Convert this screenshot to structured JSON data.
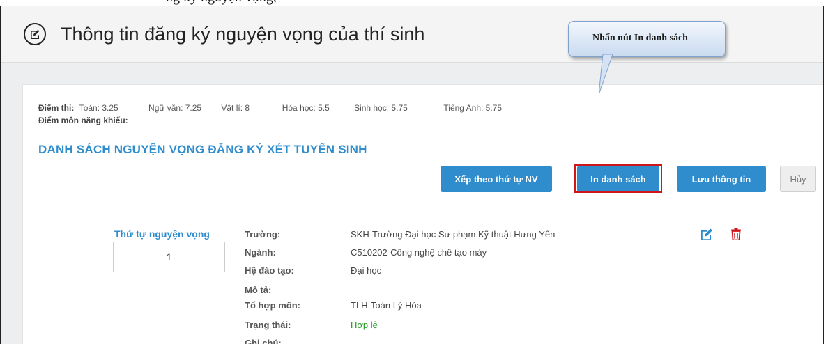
{
  "top_fragment": "ng ký nguyện vọng, ",
  "header": {
    "title": "Thông tin đăng ký nguyện vọng của thí sinh",
    "icon": "edit-circle-icon"
  },
  "scores": {
    "label": "Điểm thi:",
    "items": [
      "Toán: 3.25",
      "Ngữ văn: 7.25",
      "Vật lí: 8",
      "Hóa học: 5.5",
      "Sinh học: 5.75",
      "Tiếng Anh: 5.75"
    ],
    "aptitude_label": "Điểm môn năng khiếu:"
  },
  "list_title": "DANH SÁCH NGUYỆN VỌNG ĐĂNG KÝ XÉT TUYỂN SINH",
  "buttons": {
    "sort": "Xếp theo thứ tự NV",
    "print": "In danh sách",
    "save": "Lưu thông tin",
    "cancel": "Hủy"
  },
  "callout": "Nhấn nút In danh sách",
  "choice": {
    "order_label": "Thứ tự nguyện vọng",
    "order_value": "1",
    "rows": [
      {
        "label": "Trường:",
        "value": "SKH-Trường Đại học Sư phạm Kỹ thuật Hưng Yên"
      },
      {
        "label": "Ngành:",
        "value": "C510202-Công nghệ chế tạo máy"
      },
      {
        "label": "Hệ đào tạo:",
        "value": "Đại học"
      },
      {
        "label": "Mô tả:",
        "value": ""
      },
      {
        "label": "Tổ hợp môn:",
        "value": "TLH-Toán Lý Hóa"
      },
      {
        "label": "Trạng thái:",
        "value": "Hợp lệ"
      },
      {
        "label": "Ghi chú:",
        "value": ""
      }
    ]
  },
  "colors": {
    "primary": "#2f8dcd",
    "valid": "#1e9a1e",
    "delete": "#d0161d"
  }
}
